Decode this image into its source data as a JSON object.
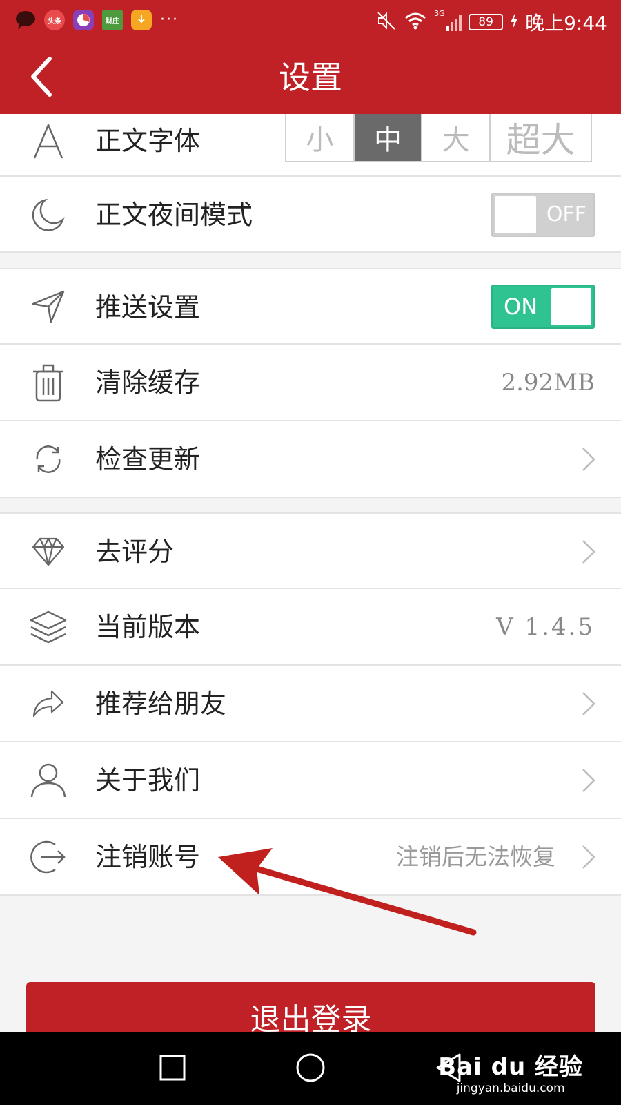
{
  "status_bar": {
    "app_icons": [
      {
        "name": "message-icon",
        "color": "#e23b3b"
      },
      {
        "name": "toutiao-app-icon",
        "text": "头条",
        "color": "#e84b4b"
      },
      {
        "name": "pie-app-icon",
        "color": "#8a3fb8"
      },
      {
        "name": "caizhuang-app-icon",
        "text": "财庄",
        "color": "#4e9a3c"
      },
      {
        "name": "orange-app-icon",
        "color": "#f5a623"
      }
    ],
    "more": "···",
    "network": "3G",
    "battery": "89",
    "time": "晚上9:44"
  },
  "nav": {
    "title": "设置"
  },
  "colors": {
    "brand": "#c02126",
    "toggle_on": "#2fc392",
    "toggle_off": "#d0d0d0"
  },
  "settings": {
    "font": {
      "label": "正文字体",
      "icon": "letter-a-icon",
      "options": [
        "小",
        "中",
        "大",
        "超大"
      ],
      "selected": "中"
    },
    "night_mode": {
      "label": "正文夜间模式",
      "icon": "moon-icon",
      "toggle": "OFF"
    },
    "push": {
      "label": "推送设置",
      "icon": "send-icon",
      "toggle": "ON"
    },
    "cache": {
      "label": "清除缓存",
      "icon": "trash-icon",
      "value": "2.92MB"
    },
    "update": {
      "label": "检查更新",
      "icon": "refresh-icon"
    },
    "rate": {
      "label": "去评分",
      "icon": "diamond-icon"
    },
    "version": {
      "label": "当前版本",
      "icon": "layers-icon",
      "value": "V 1.4.5"
    },
    "share": {
      "label": "推荐给朋友",
      "icon": "share-icon"
    },
    "about": {
      "label": "关于我们",
      "icon": "user-icon"
    },
    "deregister": {
      "label": "注销账号",
      "icon": "logout-icon",
      "hint": "注销后无法恢复"
    }
  },
  "logout_button": "退出登录",
  "watermark": {
    "logo": "Bai du 经验",
    "url": "jingyan.baidu.com"
  }
}
